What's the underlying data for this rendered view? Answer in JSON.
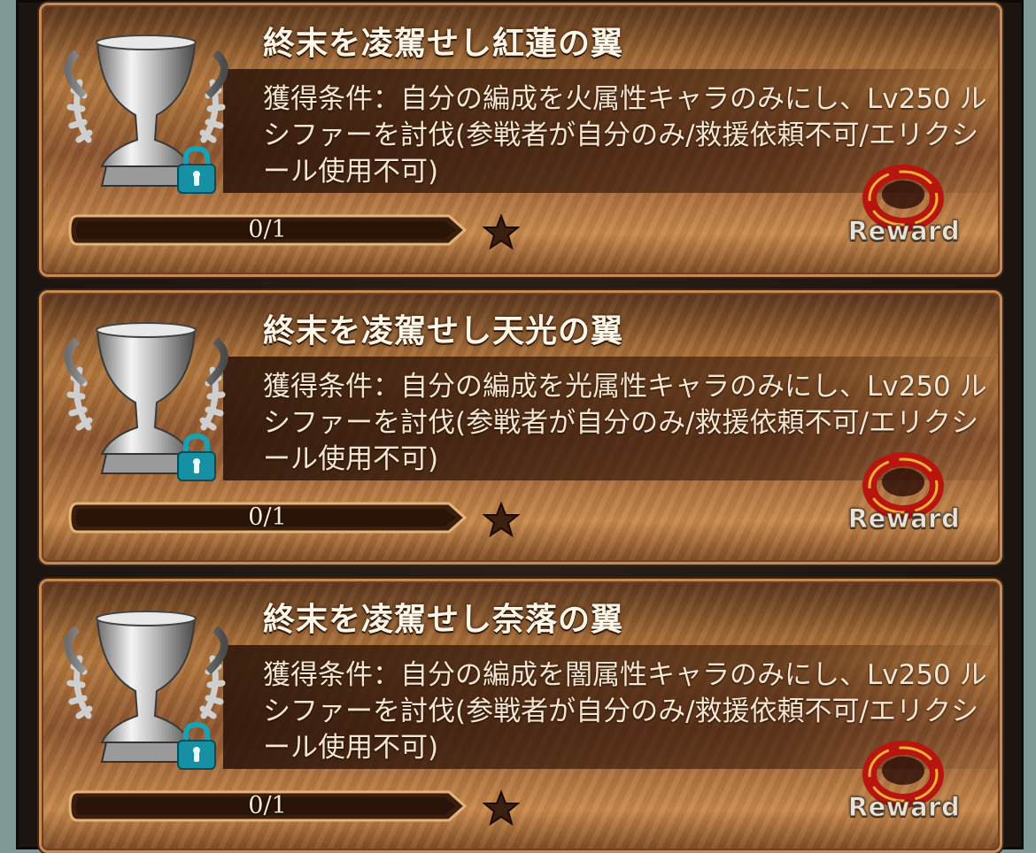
{
  "achievements": [
    {
      "title": "終末を凌駕せし紅蓮の翼",
      "condition": "獲得条件：自分の編成を火属性キャラのみにし、Lv250 ルシファーを討伐(参戦者が自分のみ/救援依頼不可/エリクシール使用不可)",
      "progress_text": "0/1",
      "progress_fraction": 0,
      "reward_label": "Reward",
      "locked": true
    },
    {
      "title": "終末を凌駕せし天光の翼",
      "condition": "獲得条件：自分の編成を光属性キャラのみにし、Lv250 ルシファーを討伐(参戦者が自分のみ/救援依頼不可/エリクシール使用不可)",
      "progress_text": "0/1",
      "progress_fraction": 0,
      "reward_label": "Reward",
      "locked": true
    },
    {
      "title": "終末を凌駕せし奈落の翼",
      "condition": "獲得条件：自分の編成を闇属性キャラのみにし、Lv250 ルシファーを討伐(参戦者が自分のみ/救援依頼不可/エリクシール使用不可)",
      "progress_text": "0/1",
      "progress_fraction": 0,
      "reward_label": "Reward",
      "locked": true
    }
  ],
  "icons": {
    "trophy": "silver-trophy-icon",
    "lock": "lock-icon",
    "star": "star-icon",
    "reward": "red-ring-icon"
  },
  "colors": {
    "title_text": "#fff6e8",
    "lock_teal": "#1aa6b8",
    "ring_red": "#d0201a",
    "ring_gold": "#f2b134"
  }
}
